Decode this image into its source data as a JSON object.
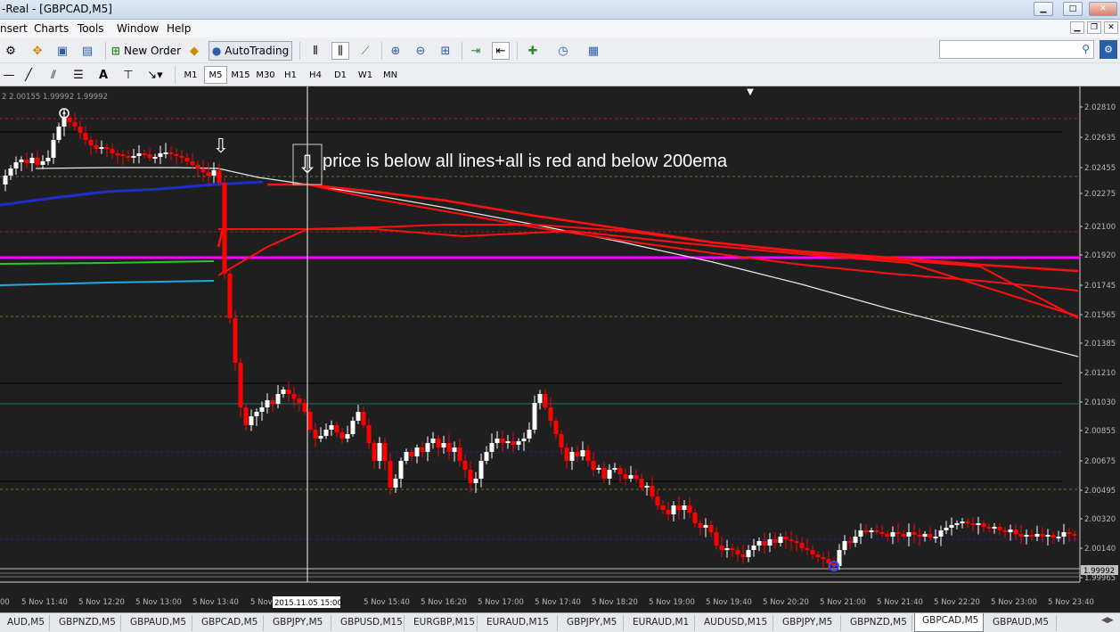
{
  "window": {
    "title": "-Real - [GBPCAD,M5]"
  },
  "menu": [
    "nsert",
    "Charts",
    "Tools",
    "Window",
    "Help"
  ],
  "toolbar": {
    "new_order": "New Order",
    "autotrading": "AutoTrading"
  },
  "timeframes": [
    "M1",
    "M5",
    "M15",
    "M30",
    "H1",
    "H4",
    "D1",
    "W1",
    "MN"
  ],
  "active_timeframe": "M5",
  "chart": {
    "info": "2 2.00155 1.99992 1.99992",
    "annotation": "price is below all lines+all is red and below 200ema",
    "crosshair_label": "2015.11.05 15:00",
    "current_price": "1.99992",
    "price_labels": [
      "2.02810",
      "2.02635",
      "2.02455",
      "2.02275",
      "2.02100",
      "2.01920",
      "2.01745",
      "2.01565",
      "2.01385",
      "2.01210",
      "2.01030",
      "2.00855",
      "2.00675",
      "2.00495",
      "2.00320",
      "2.00140",
      "1.99965"
    ],
    "time_labels": [
      "00",
      "5 Nov 11:40",
      "5 Nov 12:20",
      "5 Nov 13:00",
      "5 Nov 13:40",
      "5 Nov",
      "5 Nov 15:40",
      "5 Nov 16:20",
      "5 Nov 17:00",
      "5 Nov 17:40",
      "5 Nov 18:20",
      "5 Nov 19:00",
      "5 Nov 19:40",
      "5 Nov 20:20",
      "5 Nov 21:00",
      "5 Nov 21:40",
      "5 Nov 22:20",
      "5 Nov 23:00",
      "5 Nov 23:40"
    ],
    "colors": {
      "background": "#1f1f1f",
      "bull": "#ffffff",
      "bear": "#ff0000",
      "ema200": "#ffffff",
      "magenta": "#ff00ff"
    }
  },
  "tabs": [
    "AUD,M5",
    "GBPNZD,M5",
    "GBPAUD,M5",
    "GBPCAD,M5",
    "GBPJPY,M5",
    "GBPUSD,M15",
    "EURGBP,M15",
    "EURAUD,M15",
    "GBPJPY,M5",
    "EURAUD,M1",
    "AUDUSD,M15",
    "GBPJPY,M5",
    "GBPNZD,M5",
    "GBPCAD,M5",
    "GBPAUD,M5"
  ],
  "active_tab": 13
}
